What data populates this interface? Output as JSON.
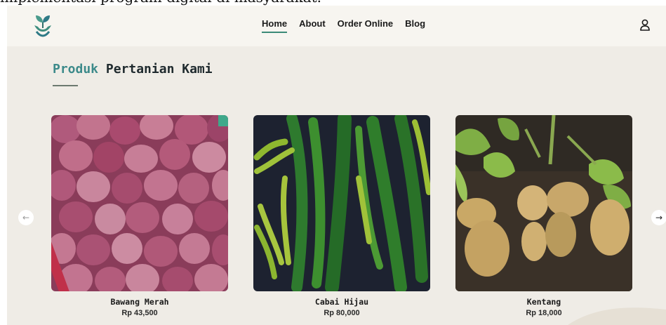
{
  "caption": {
    "text": "implementasi program digital di masyarakat."
  },
  "header": {
    "logo_icon": "sprout-hand-icon",
    "nav": [
      {
        "label": "Home",
        "active": true
      },
      {
        "label": "About",
        "active": false
      },
      {
        "label": "Order Online",
        "active": false
      },
      {
        "label": "Blog",
        "active": false
      }
    ],
    "user_icon": "user-icon"
  },
  "section": {
    "title_accent": "Produk",
    "title_rest": "Pertanian Kami"
  },
  "products": [
    {
      "name": "Bawang Merah",
      "price": "Rp 43,500",
      "image": "red-shallots"
    },
    {
      "name": "Cabai Hijau",
      "price": "Rp 80,000",
      "image": "green-chilies"
    },
    {
      "name": "Kentang",
      "price": "Rp 18,000",
      "image": "potatoes"
    }
  ],
  "carousel": {
    "prev_icon": "arrow-left-icon",
    "next_icon": "arrow-right-icon"
  },
  "colors": {
    "accent": "#3c8a78",
    "page_bg": "#efece6",
    "navbar_bg": "#f7f5f0"
  }
}
